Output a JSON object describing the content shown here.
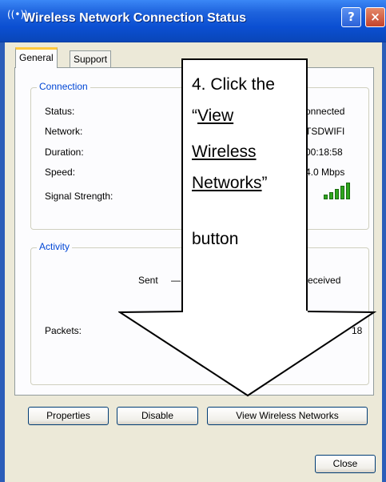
{
  "window": {
    "title": "Wireless Network Connection Status",
    "icon": "wireless-signal-icon",
    "help_glyph": "?",
    "close_glyph": "×"
  },
  "tabs": [
    {
      "label": "General",
      "selected": true
    },
    {
      "label": "Support",
      "selected": false
    }
  ],
  "connection": {
    "title": "Connection",
    "rows": [
      {
        "label": "Status:",
        "value": "onnected"
      },
      {
        "label": "Network:",
        "value": "TSDWIFI"
      },
      {
        "label": "Duration:",
        "value": "00:18:58"
      },
      {
        "label": "Speed:",
        "value": "4.0 Mbps"
      }
    ],
    "signal_label": "Signal Strength:",
    "signal_bars": 5
  },
  "activity": {
    "title": "Activity",
    "sent_label": "Sent",
    "sent_dash": "—",
    "received_label": "eceived",
    "packets_label": "Packets:",
    "packets_received": "18"
  },
  "buttons": {
    "properties": "Properties",
    "disable": "Disable",
    "view_wireless": "View Wireless Networks",
    "close": "Close"
  },
  "callout": {
    "line1": "4. Click the",
    "line2_open": "“",
    "line2_link": "View",
    "line3": "Wireless",
    "line4_link": "Networks",
    "line4_close": "”",
    "line5": "button"
  },
  "colors": {
    "titlebar": "#0b4fd2",
    "dialog_bg": "#ece9d8",
    "group_title": "#0046d5",
    "signal_bar": "#2fa61d"
  }
}
